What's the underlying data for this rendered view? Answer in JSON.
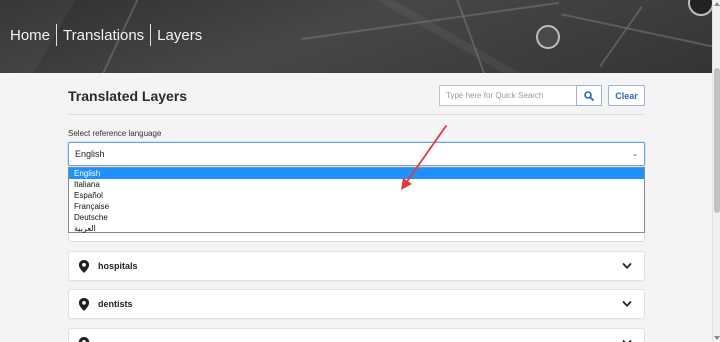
{
  "breadcrumb": {
    "items": [
      "Home",
      "Translations",
      "Layers"
    ]
  },
  "panel": {
    "title": "Translated Layers",
    "search_placeholder": "Type here for Quick Search",
    "clear_label": "Clear",
    "reference_label": "Select reference language",
    "selected_language": "English"
  },
  "dropdown": {
    "options": [
      "English",
      "Italiana",
      "Español",
      "Française",
      "Deutsche",
      "العربية"
    ],
    "highlighted": "English"
  },
  "layers": [
    {
      "label": "hospitals"
    },
    {
      "label": "dentists"
    },
    {
      "label": ""
    }
  ],
  "colors": {
    "accent": "#1e90ff",
    "link_blue": "#2a66b8",
    "annotation_red": "#e03a3a"
  },
  "icons": {
    "search": "magnifier-icon",
    "pin": "map-pin-icon",
    "chevron": "chevron-down-icon"
  }
}
